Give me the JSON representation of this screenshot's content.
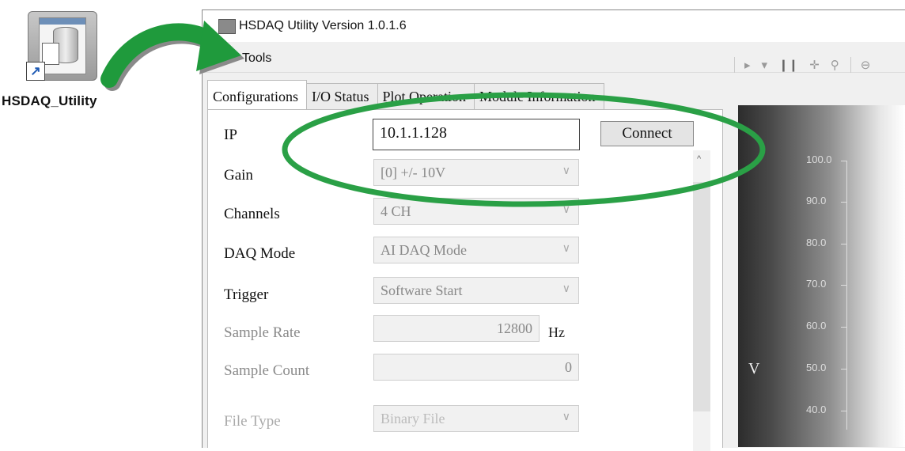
{
  "desktop": {
    "shortcut_label": "HSDAQ_Utility"
  },
  "window": {
    "title": "HSDAQ Utility Version 1.0.1.6"
  },
  "menu": {
    "tools": "Tools"
  },
  "toolbar": {
    "play": "▸",
    "dropdown": "▾",
    "pause": "❙❙",
    "pan": "✛",
    "zoom_select": "⚲",
    "zoom_out": "⊖"
  },
  "tabs": [
    "Configurations",
    "I/O Status",
    "Plot Operation",
    "Module Information"
  ],
  "form": {
    "ip": {
      "label": "IP",
      "value": "10.1.1.128"
    },
    "connect": "Connect",
    "gain": {
      "label": "Gain",
      "value": "[0] +/- 10V"
    },
    "channels": {
      "label": "Channels",
      "value": "4 CH"
    },
    "daq_mode": {
      "label": "DAQ Mode",
      "value": "AI DAQ Mode"
    },
    "trigger": {
      "label": "Trigger",
      "value": "Software Start"
    },
    "sample_rate": {
      "label": "Sample Rate",
      "value": "12800",
      "unit": "Hz"
    },
    "sample_count": {
      "label": "Sample Count",
      "value": "0"
    },
    "file_type": {
      "label": "File Type",
      "value": "Binary File"
    }
  },
  "chart": {
    "y_ticks": [
      "100.0",
      "90.0",
      "80.0",
      "70.0",
      "60.0",
      "50.0",
      "40.0"
    ],
    "y_unit": "V"
  },
  "colors": {
    "highlight_green": "#2aa046",
    "arrow_green": "#1f9a3c"
  }
}
